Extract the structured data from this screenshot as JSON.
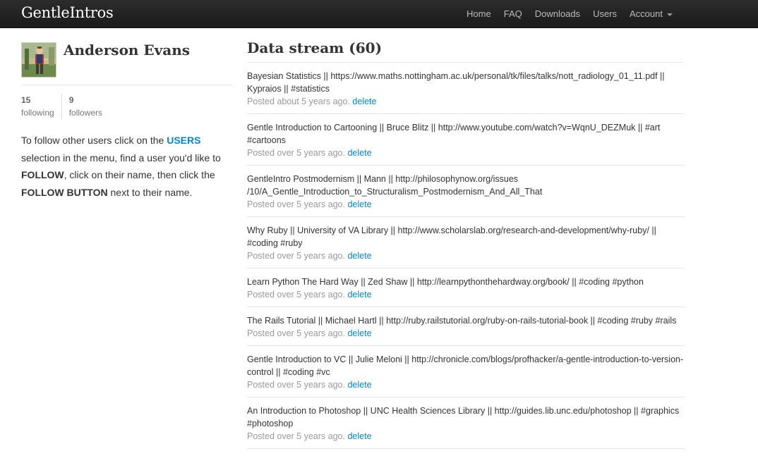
{
  "nav": {
    "brand": "GentleIntros",
    "items": [
      "Home",
      "FAQ",
      "Downloads",
      "Users",
      "Account"
    ]
  },
  "user": {
    "name": "Anderson Evans",
    "following_count": "15",
    "following_label": "following",
    "followers_count": "9",
    "followers_label": "followers"
  },
  "help": {
    "part1": "To follow other users click on the ",
    "users_link": "USERS",
    "part2": " selection in the menu, find a user you'd like to ",
    "follow": "FOLLOW",
    "part3": ", click on their name, then click the ",
    "follow_button": "FOLLOW BUTTON",
    "part4": " next to their name."
  },
  "stream": {
    "title": "Data stream (60)",
    "delete_label": "delete",
    "posts": [
      {
        "content": "Bayesian Statistics || https://www.maths.nottingham.ac.uk/personal/tk/files/talks/nott_radiology_01_11.pdf || Kypraios || #statistics",
        "meta": "Posted about 5 years ago."
      },
      {
        "content": "Gentle Introduction to Cartooning || Bruce Blitz || http://www.youtube.com/watch?v=WqnU_DEZMuk || #art #cartoons",
        "meta": "Posted over 5 years ago."
      },
      {
        "content": "GentleIntro Postmodernism || Mann || http://philosophynow.org/issues /10/A_Gentle_Introduction_to_Structuralism_Postmodernism_And_All_That",
        "meta": "Posted over 5 years ago."
      },
      {
        "content": "Why Ruby || University of VA Library || http://www.scholarslab.org/research-and-development/why-ruby/ || #coding #ruby",
        "meta": "Posted over 5 years ago."
      },
      {
        "content": "Learn Python The Hard Way || Zed Shaw || http://learnpythonthehardway.org/book/ || #coding #python",
        "meta": "Posted over 5 years ago."
      },
      {
        "content": "The Rails Tutorial || Michael Hartl || http://ruby.railstutorial.org/ruby-on-rails-tutorial-book || #coding #ruby #rails",
        "meta": "Posted over 5 years ago."
      },
      {
        "content": "Gentle Introduction to VC || Julie Meloni || http://chronicle.com/blogs/profhacker/a-gentle-introduction-to-version-control || #coding #vc",
        "meta": "Posted over 5 years ago."
      },
      {
        "content": "An Introduction to Photoshop || UNC Health Sciences Library || http://guides.lib.unc.edu/photoshop || #graphics #photoshop",
        "meta": "Posted over 5 years ago."
      }
    ]
  }
}
